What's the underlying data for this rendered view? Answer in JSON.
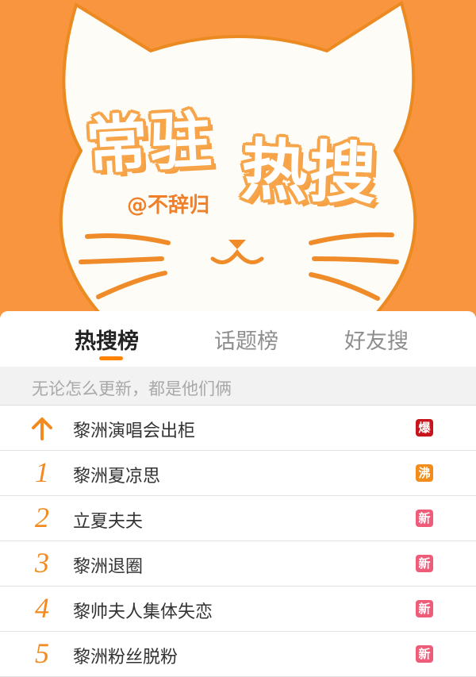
{
  "banner": {
    "title_part1": "常驻",
    "title_part2": "热搜",
    "author": "@不辞归"
  },
  "tabs": [
    {
      "label": "热搜榜",
      "active": true
    },
    {
      "label": "话题榜",
      "active": false
    },
    {
      "label": "好友搜",
      "active": false
    }
  ],
  "search_hint": "无论怎么更新，都是他们俩",
  "colors": {
    "banner_bg": "#f9953f",
    "accent": "#ff8200",
    "badge_bao": "#c8151d",
    "badge_fei": "#f28c1b",
    "badge_xin": "#ef5c7a"
  },
  "list": [
    {
      "rank": "",
      "rank_icon": "up-arrow-icon",
      "label": "黎洲演唱会出柜",
      "badge": "爆",
      "badge_color": "#c8151d"
    },
    {
      "rank": "1",
      "label": "黎洲夏凉思",
      "badge": "沸",
      "badge_color": "#f28c1b"
    },
    {
      "rank": "2",
      "label": "立夏夫夫",
      "badge": "新",
      "badge_color": "#ef5c7a"
    },
    {
      "rank": "3",
      "label": "黎洲退圈",
      "badge": "新",
      "badge_color": "#ef5c7a"
    },
    {
      "rank": "4",
      "label": "黎帅夫人集体失恋",
      "badge": "新",
      "badge_color": "#ef5c7a"
    },
    {
      "rank": "5",
      "label": "黎洲粉丝脱粉",
      "badge": "新",
      "badge_color": "#ef5c7a"
    }
  ]
}
